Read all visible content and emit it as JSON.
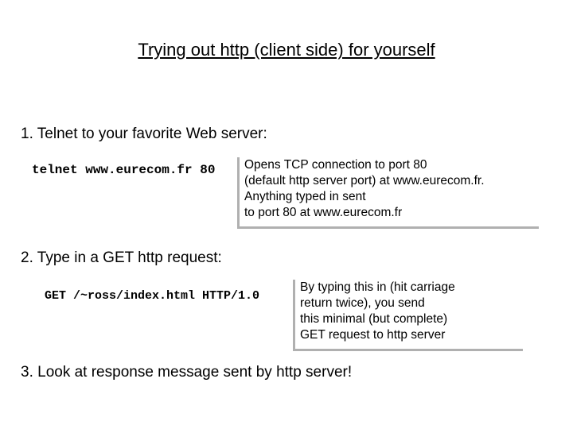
{
  "title": "Trying out http (client side) for yourself",
  "steps": {
    "s1_label": "1. Telnet to your favorite Web server:",
    "s1_cmd": "telnet www.eurecom.fr 80",
    "s1_note_l1": "Opens TCP connection to port 80",
    "s1_note_l2": "(default http server port) at www.eurecom.fr.",
    "s1_note_l3": "Anything typed in sent",
    "s1_note_l4": "to port 80 at www.eurecom.fr",
    "s2_label": "2. Type in a GET http request:",
    "s2_cmd": "GET /~ross/index.html HTTP/1.0",
    "s2_note_l1": "By typing this in (hit carriage",
    "s2_note_l2": "return twice), you send",
    "s2_note_l3": "this minimal (but complete)",
    "s2_note_l4": "GET request to http server",
    "s3_label": "3. Look at response message sent by http server!"
  }
}
